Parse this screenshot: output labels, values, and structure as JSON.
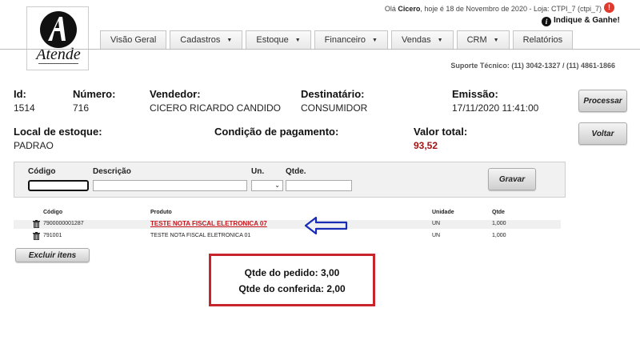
{
  "header": {
    "greeting_prefix": "Olá",
    "user": "Cicero",
    "greeting_suffix": ", hoje é 18 de Novembro de 2020 - Loja: CTPI_7 (ctpi_7)",
    "indique": "Indique & Ganhe!",
    "suporte": "Suporte Técnico: (11) 3042-1327 / (11) 4861-1866"
  },
  "logo": {
    "text": "Atende"
  },
  "nav": {
    "tabs": [
      {
        "label": "Visão Geral",
        "dropdown": false
      },
      {
        "label": "Cadastros",
        "dropdown": true
      },
      {
        "label": "Estoque",
        "dropdown": true
      },
      {
        "label": "Financeiro",
        "dropdown": true
      },
      {
        "label": "Vendas",
        "dropdown": true
      },
      {
        "label": "CRM",
        "dropdown": true
      },
      {
        "label": "Relatórios",
        "dropdown": false
      }
    ]
  },
  "order": {
    "id_label": "Id:",
    "id": "1514",
    "numero_label": "Número:",
    "numero": "716",
    "vendedor_label": "Vendedor:",
    "vendedor": "CICERO RICARDO CANDIDO",
    "destinatario_label": "Destinatário:",
    "destinatario": "CONSUMIDOR",
    "emissao_label": "Emissão:",
    "emissao": "17/11/2020 11:41:00",
    "local_label": "Local de estoque:",
    "local": "PADRAO",
    "condicao_label": "Condição de pagamento:",
    "valor_label": "Valor total:",
    "valor": "93,52"
  },
  "buttons": {
    "processar": "Processar",
    "voltar": "Voltar",
    "gravar": "Gravar",
    "excluir": "Excluir itens"
  },
  "form": {
    "codigo_label": "Código",
    "descricao_label": "Descrição",
    "un_label": "Un.",
    "qtde_label": "Qtde."
  },
  "table": {
    "headers": {
      "codigo": "Código",
      "produto": "Produto",
      "unidade": "Unidade",
      "qtde": "Qtde"
    },
    "rows": [
      {
        "codigo": "7900000001287",
        "produto": "TESTE NOTA FISCAL ELETRONICA 07",
        "unidade": "UN",
        "qtde": "1,000"
      },
      {
        "codigo": "791001",
        "produto": "TESTE NOTA FISCAL ELETRONICA 01",
        "unidade": "UN",
        "qtde": "1,000"
      }
    ]
  },
  "annotation": {
    "line1": "Qtde do pedido: 3,00",
    "line2": "Qtde do conferida: 2,00",
    "arrow_color": "#1a2bb8",
    "box_color": "#c8242b"
  },
  "icons": [
    "atende-logo-icon",
    "warning-icon",
    "info-icon",
    "trash-icon",
    "arrow-left-icon"
  ]
}
